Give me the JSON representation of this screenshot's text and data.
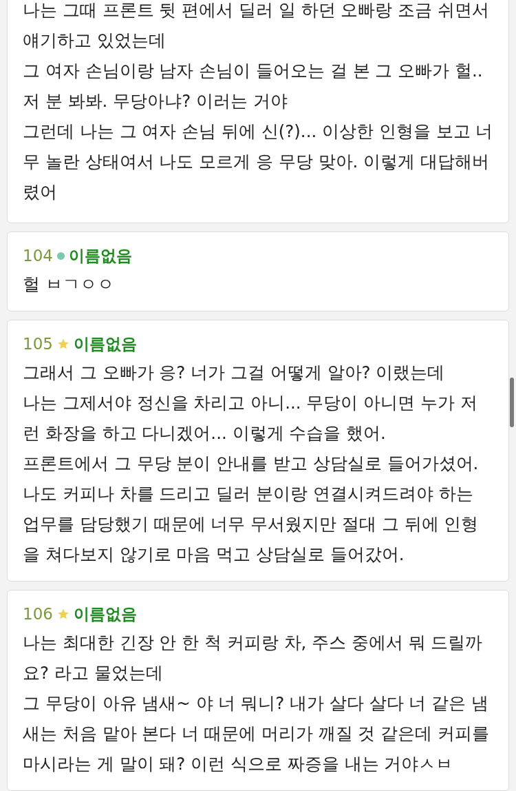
{
  "posts": [
    {
      "kind": "continued",
      "paragraphs": [
        "나는 그때 프론트 뒷 편에서 딜러 일 하던 오빠랑 조금 쉬면서 얘기하고 있었는데",
        "그 여자 손님이랑 남자 손님이 들어오는 걸 본 그 오빠가 헐.. 저 분 봐봐. 무당아냐? 이러는 거야",
        "그런데 나는 그 여자 손님 뒤에 신(?)... 이상한 인형을 보고 너무 놀란 상태여서 나도 모르게 응 무당 맞아. 이렇게 대답해버렸어"
      ]
    },
    {
      "kind": "dot",
      "number": "104",
      "name": "이름없음",
      "paragraphs": [
        "헐 ㅂㄱㅇㅇ"
      ]
    },
    {
      "kind": "star",
      "number": "105",
      "name": "이름없음",
      "paragraphs": [
        "그래서 그 오빠가 응? 너가 그걸 어떻게 알아? 이랬는데",
        "나는 그제서야 정신을 차리고 아니... 무당이 아니면 누가 저런 화장을 하고 다니겠어... 이렇게 수습을 했어.",
        "프론트에서 그 무당 분이 안내를 받고 상담실로 들어가셨어.",
        "나도 커피나 차를 드리고 딜러 분이랑 연결시켜드려야 하는 업무를 담당했기 때문에 너무 무서웠지만 절대 그 뒤에 인형을 쳐다보지 않기로 마음 먹고 상담실로 들어갔어."
      ]
    },
    {
      "kind": "star",
      "number": "106",
      "name": "이름없음",
      "paragraphs": [
        "나는 최대한 긴장 안 한 척 커피랑 차, 주스 중에서 뭐 드릴까요? 라고 물었는데",
        "그 무당이 아유 냄새~ 야 너 뭐니? 내가 살다 살다 너 같은 냄새는 처음 맡아 본다 너 때문에 머리가 깨질 것 같은데 커피를 마시라는 게 말이 돼? 이런 식으로 짜증을 내는 거야ㅅㅂ"
      ]
    }
  ]
}
